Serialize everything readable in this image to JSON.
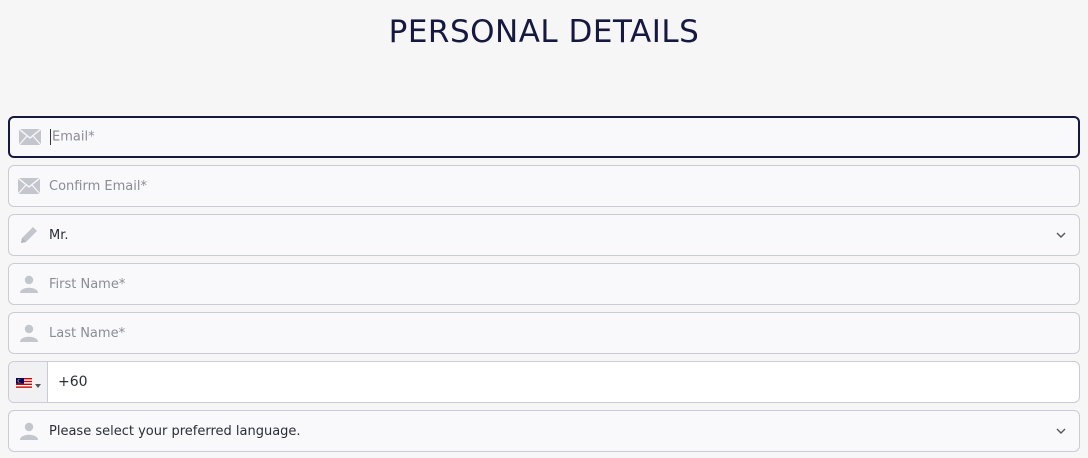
{
  "page": {
    "title": "PERSONAL DETAILS"
  },
  "form": {
    "email": {
      "placeholder": "Email*",
      "icon": "envelope-icon",
      "focused": true
    },
    "confirm_email": {
      "placeholder": "Confirm Email*",
      "icon": "envelope-icon"
    },
    "salutation": {
      "selected": "Mr.",
      "icon": "pencil-icon"
    },
    "first_name": {
      "placeholder": "First Name*",
      "icon": "person-icon"
    },
    "last_name": {
      "placeholder": "Last Name*",
      "icon": "person-icon"
    },
    "phone": {
      "value": "+60",
      "country_flag": "malaysia-flag-icon"
    },
    "language": {
      "placeholder": "Please select your preferred language.",
      "icon": "person-icon"
    }
  },
  "colors": {
    "title": "#16193f",
    "focus_border": "#16193f",
    "border": "#c9ccd4",
    "field_bg": "#f9f9fb",
    "icon": "#c3c6cd",
    "background": "#f6f6f6"
  }
}
